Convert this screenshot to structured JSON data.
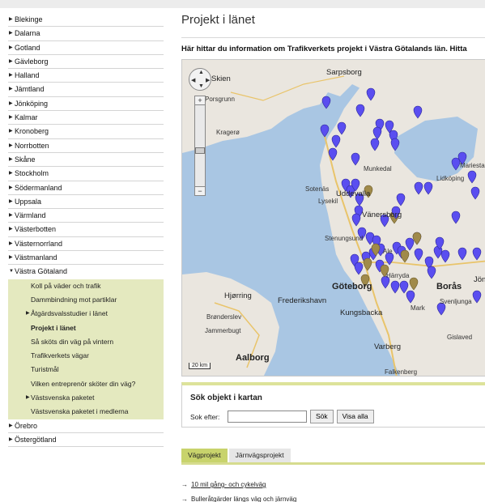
{
  "sidebar": {
    "items": [
      {
        "label": "Blekinge"
      },
      {
        "label": "Dalarna"
      },
      {
        "label": "Gotland"
      },
      {
        "label": "Gävleborg"
      },
      {
        "label": "Halland"
      },
      {
        "label": "Jämtland"
      },
      {
        "label": "Jönköping"
      },
      {
        "label": "Kalmar"
      },
      {
        "label": "Kronoberg"
      },
      {
        "label": "Norrbotten"
      },
      {
        "label": "Skåne"
      },
      {
        "label": "Stockholm"
      },
      {
        "label": "Södermanland"
      },
      {
        "label": "Uppsala"
      },
      {
        "label": "Värmland"
      },
      {
        "label": "Västerbotten"
      },
      {
        "label": "Västernorrland"
      },
      {
        "label": "Västmanland"
      }
    ],
    "open_item": {
      "label": "Västra Götaland"
    },
    "sub_items": [
      {
        "label": "Koll på väder och trafik"
      },
      {
        "label": "Dammbindning mot partiklar"
      },
      {
        "label": "Åtgärdsvalsstudier i länet"
      },
      {
        "label": "Projekt i länet"
      },
      {
        "label": "Så sköts din väg på vintern"
      },
      {
        "label": "Trafikverkets vägar"
      },
      {
        "label": "Turistmål"
      },
      {
        "label": "Vilken entreprenör sköter din väg?"
      },
      {
        "label": "Västsvenska paketet"
      },
      {
        "label": "Västsvenska paketet i medlerna"
      }
    ],
    "after_items": [
      {
        "label": "Örebro"
      },
      {
        "label": "Östergötland"
      }
    ]
  },
  "main": {
    "title": "Projekt i länet",
    "intro": "Här hittar du information om Trafikverkets projekt i Västra Götalands län. Hitta",
    "map": {
      "labels": {
        "skien": "Skien",
        "porsgrunn": "Porsgrunn",
        "sarpsborg": "Sarpsborg",
        "kragero": "Kragerø",
        "hjorring": "Hjørring",
        "frederikshavn": "Frederikshavn",
        "bronderslev": "Brønderslev",
        "jammerbugt": "Jammerbugt",
        "aalborg": "Aalborg",
        "goteborg": "Göteborg",
        "boras": "Borås",
        "kungsbacka": "Kungsbacka",
        "varberg": "Varberg",
        "falkenberg": "Falkenberg",
        "gislaved": "Gislaved",
        "stenungsund": "Stenungsund",
        "uddevalla": "Uddevalla",
        "vanersborg": "Vänersborg",
        "lidkoping": "Lidköping",
        "mariestad": "Mariestad",
        "jonkoping": "Jön",
        "ale": "Ale",
        "mark": "Mark",
        "svenljunga": "Svenljunga",
        "lysekil": "Lysekil",
        "sotenas": "Sotenäs",
        "munkedal": "Munkedal",
        "harryda": "Härryda"
      },
      "scale": "20 km"
    },
    "search": {
      "title": "Sök objekt i kartan",
      "label": "Sok efter:",
      "input_value": "",
      "search_button": "Sök",
      "show_all_button": "Visa alla"
    },
    "tabs": [
      {
        "label": "Vägprojekt"
      },
      {
        "label": "Järnvägsprojekt"
      }
    ],
    "links": [
      {
        "label": "10 mil gång- och cykelväg"
      },
      {
        "label": "Bulleråtgärder längs väg och järnväg"
      }
    ]
  },
  "colors": {
    "accent": "#c8d36c",
    "subnav_bg": "#e4e9bf",
    "pin_primary": "#5a4ef0",
    "pin_secondary": "#a08a4a",
    "water": "#a9c6e3",
    "land": "#eae6df"
  },
  "icons": {
    "nav_arrow": "right-triangle-icon",
    "nav_open_arrow": "down-triangle-icon",
    "link_arrow": "arrow-right-icon"
  }
}
